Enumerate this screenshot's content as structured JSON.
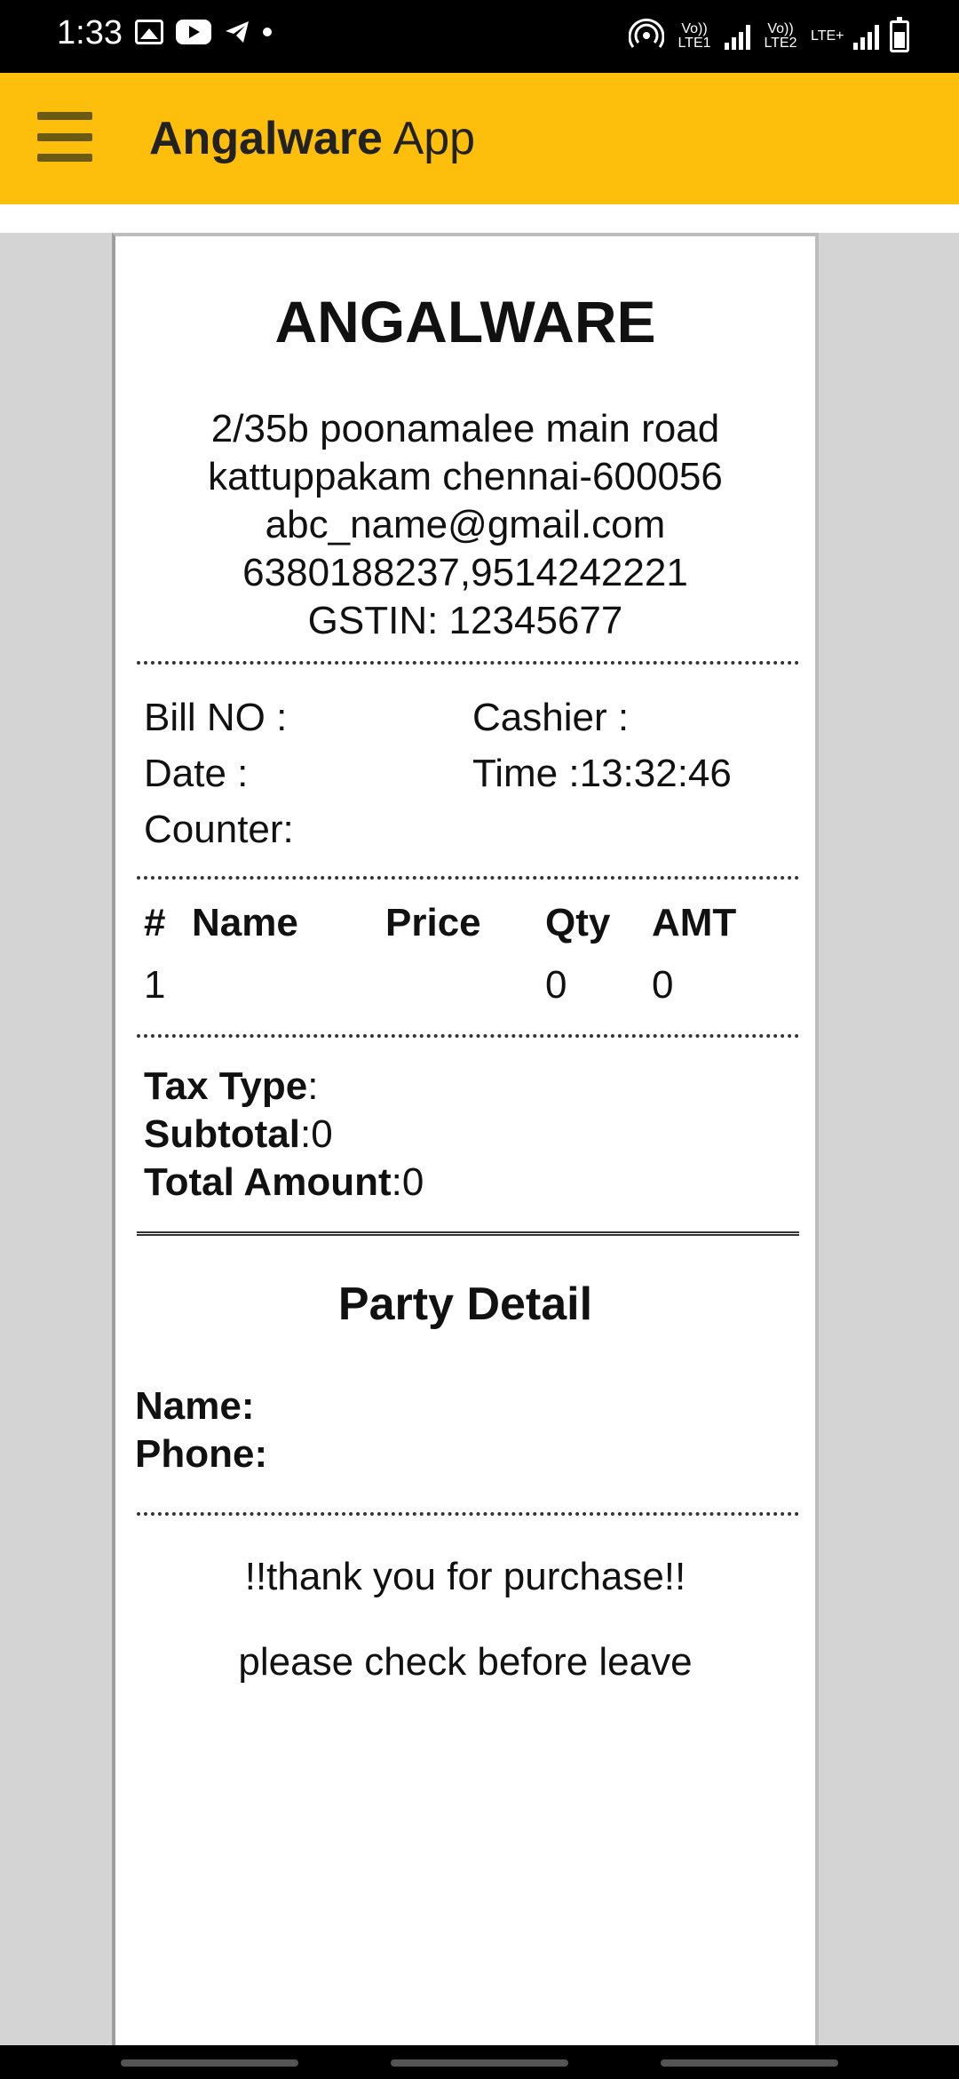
{
  "status_bar": {
    "time": "1:33",
    "sim1": "Vo)) LTE1",
    "sim2": "Vo)) LTE2",
    "sim2_extra": "LTE+",
    "icons": [
      "gallery-icon",
      "youtube-icon",
      "telegram-icon",
      "dot-icon",
      "hotspot-icon",
      "signal-icon",
      "battery-icon"
    ]
  },
  "app_bar": {
    "title_bold": "Angalware",
    "title_regular": "App",
    "accent_color": "#fdbf0c"
  },
  "receipt": {
    "shop_name": "ANGALWARE",
    "address_line1": "2/35b poonamalee main road",
    "address_line2": "kattuppakam chennai-600056",
    "email": "abc_name@gmail.com",
    "phones": "6380188237,9514242221",
    "gstin": "GSTIN: 12345677",
    "bill_no": "Bill NO :",
    "cashier": "Cashier :",
    "date": "Date :",
    "time": "Time :13:32:46",
    "counter": "Counter:",
    "columns": [
      "#",
      "Name",
      "Price",
      "Qty",
      "AMT"
    ],
    "rows": [
      {
        "num": "1",
        "name": "",
        "price": "",
        "qty": "0",
        "amt": "0"
      }
    ],
    "tax_type_label": "Tax Type",
    "tax_type_value": ":",
    "subtotal_label": "Subtotal",
    "subtotal_value": ":0",
    "total_label": "Total Amount",
    "total_value": ":0",
    "party_title": "Party Detail",
    "party_name": "Name:",
    "party_phone": "Phone:",
    "thanks": "!!thank you for purchase!!",
    "check": "please check before leave"
  }
}
